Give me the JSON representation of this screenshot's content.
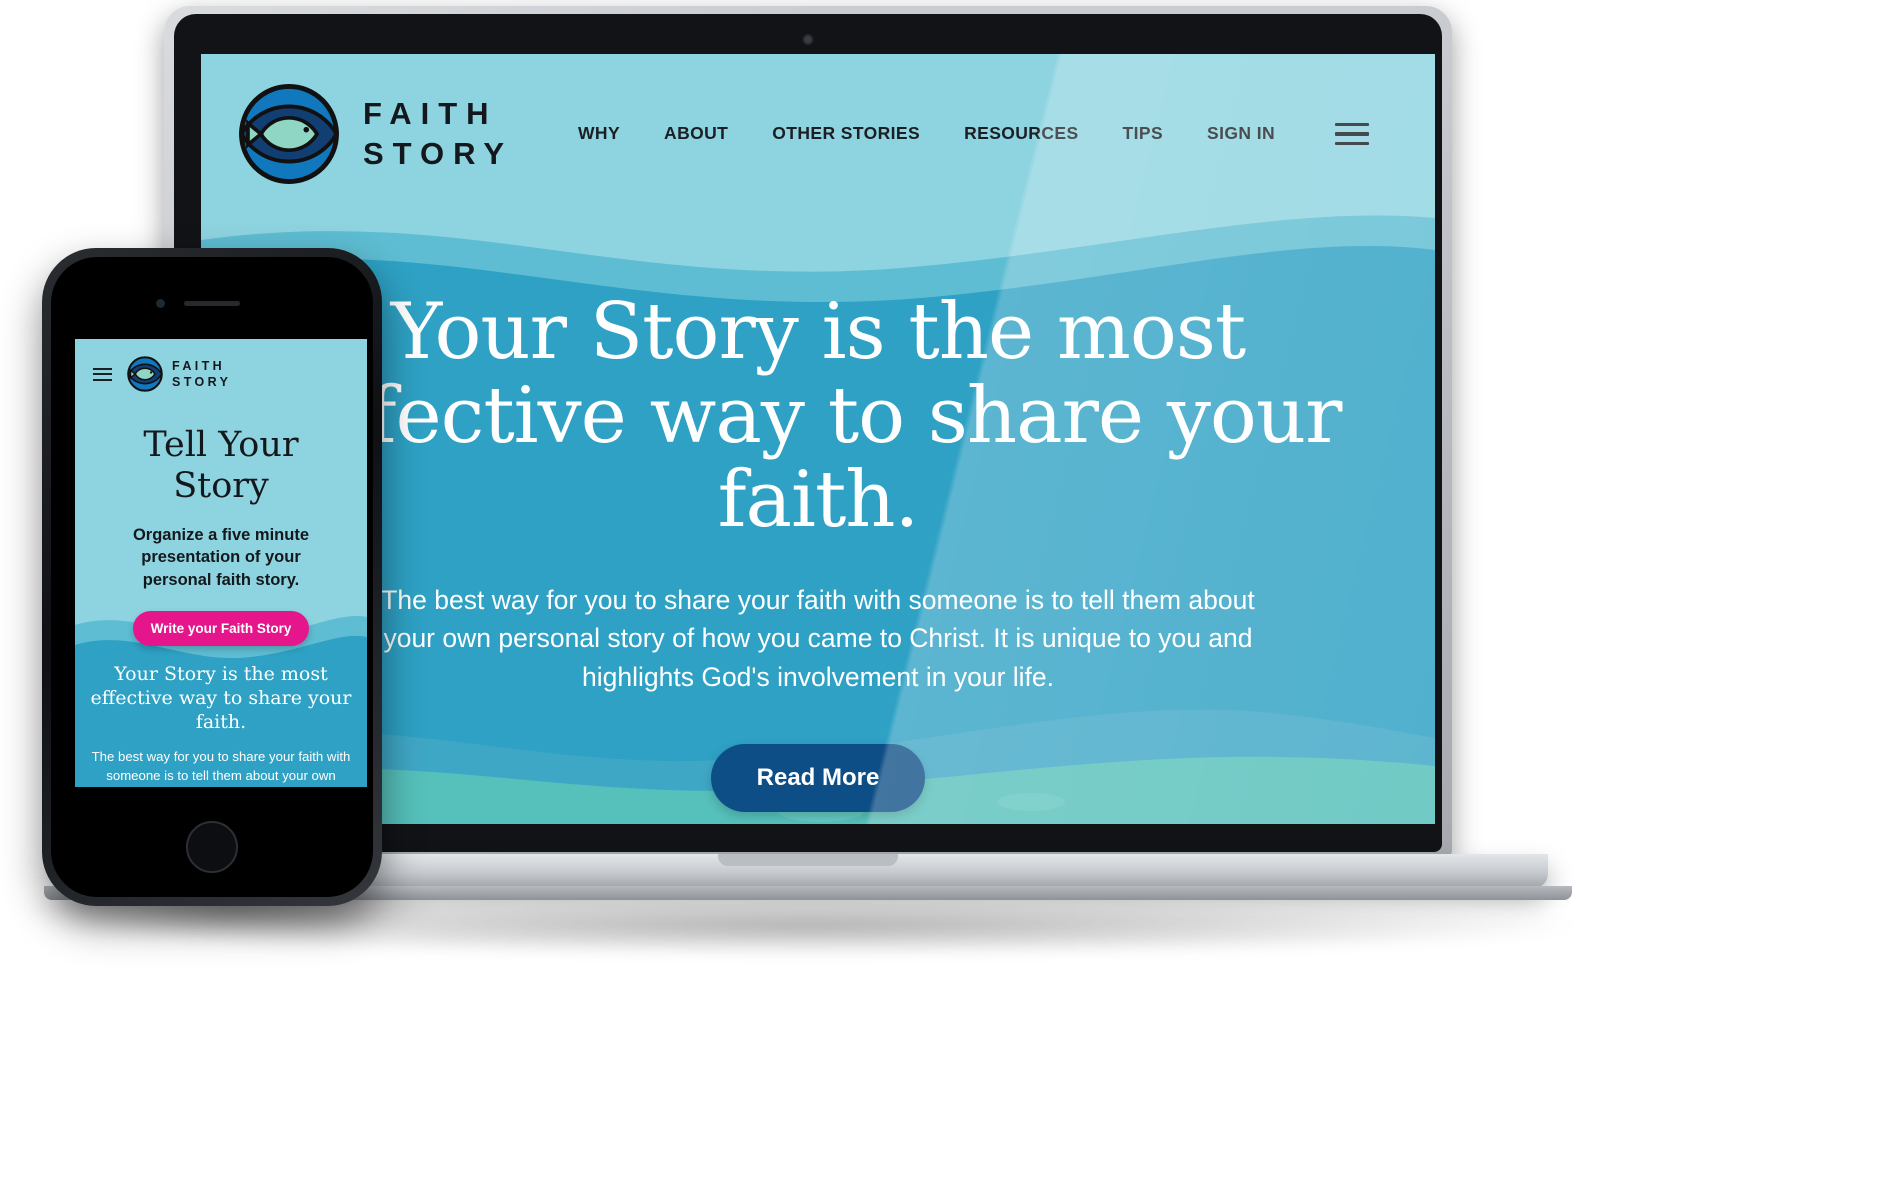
{
  "brand": {
    "line1": "FAITH",
    "line2": "STORY",
    "logo_icon": "fish-in-circle-logo-icon"
  },
  "desktop": {
    "nav": {
      "items": [
        {
          "label": "WHY"
        },
        {
          "label": "ABOUT"
        },
        {
          "label": "OTHER STORIES"
        },
        {
          "label": "RESOURCES"
        },
        {
          "label": "TIPS"
        },
        {
          "label": "SIGN IN"
        }
      ],
      "menu_icon": "hamburger-menu-icon"
    },
    "hero": {
      "title": "Your Story is the most effective way to share your faith.",
      "subtitle": "The best way for you to share your faith with someone is to tell them about your own personal story of how you came to Christ. It is unique to you and highlights God's involvement in your life.",
      "cta_label": "Read More"
    }
  },
  "mobile": {
    "nav": {
      "menu_icon": "hamburger-menu-icon"
    },
    "hero": {
      "title": "Tell Your Story",
      "subtitle": "Organize a five minute presentation of your personal faith story.",
      "cta_label": "Write your Faith Story"
    },
    "lower": {
      "title": "Your Story is the most effective way to share your faith.",
      "body": "The best way for you to share your faith with someone is to tell them about your own personal story of how you came to Christ. It is unique to you and highlights God's..."
    }
  },
  "colors": {
    "sky": "#8ed4e0",
    "sea_mid": "#2ea1c4",
    "sea_deep": "#2d9dbf",
    "teal_wave": "#56c0ba",
    "cta_blue": "#0d4e86",
    "cta_pink": "#e5158c",
    "ink": "#14181c"
  }
}
